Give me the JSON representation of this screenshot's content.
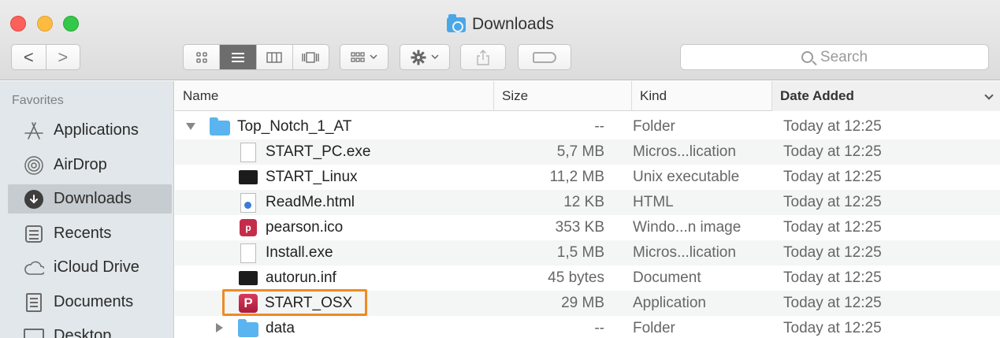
{
  "window": {
    "title": "Downloads"
  },
  "toolbar": {
    "back_label": "<",
    "forward_label": ">",
    "search_placeholder": "Search"
  },
  "sidebar": {
    "heading": "Favorites",
    "items": [
      {
        "label": "Applications",
        "icon": "applications-icon",
        "selected": false
      },
      {
        "label": "AirDrop",
        "icon": "airdrop-icon",
        "selected": false
      },
      {
        "label": "Downloads",
        "icon": "downloads-icon",
        "selected": true
      },
      {
        "label": "Recents",
        "icon": "recents-icon",
        "selected": false
      },
      {
        "label": "iCloud Drive",
        "icon": "cloud-icon",
        "selected": false
      },
      {
        "label": "Documents",
        "icon": "documents-icon",
        "selected": false
      },
      {
        "label": "Desktop",
        "icon": "desktop-icon",
        "selected": false
      }
    ]
  },
  "columns": {
    "name": "Name",
    "size": "Size",
    "kind": "Kind",
    "date_added": "Date Added"
  },
  "files": [
    {
      "name": "Top_Notch_1_AT",
      "size": "--",
      "kind": "Folder",
      "date": "Today at 12:25",
      "icon": "folder-icon",
      "indent": 0,
      "disclosure": "open"
    },
    {
      "name": "START_PC.exe",
      "size": "5,7 MB",
      "kind": "Micros...lication",
      "date": "Today at 12:25",
      "icon": "exe-file-icon",
      "indent": 1
    },
    {
      "name": "START_Linux",
      "size": "11,2 MB",
      "kind": "Unix executable",
      "date": "Today at 12:25",
      "icon": "unix-exec-icon",
      "indent": 1
    },
    {
      "name": "ReadMe.html",
      "size": "12 KB",
      "kind": "HTML",
      "date": "Today at 12:25",
      "icon": "html-file-icon",
      "indent": 1
    },
    {
      "name": "pearson.ico",
      "size": "353 KB",
      "kind": "Windo...n image",
      "date": "Today at 12:25",
      "icon": "ico-file-icon",
      "indent": 1
    },
    {
      "name": "Install.exe",
      "size": "1,5 MB",
      "kind": "Micros...lication",
      "date": "Today at 12:25",
      "icon": "exe-file-icon",
      "indent": 1
    },
    {
      "name": "autorun.inf",
      "size": "45 bytes",
      "kind": "Document",
      "date": "Today at 12:25",
      "icon": "inf-file-icon",
      "indent": 1
    },
    {
      "name": "START_OSX",
      "size": "29 MB",
      "kind": "Application",
      "date": "Today at 12:25",
      "icon": "pearson-app-icon",
      "indent": 1,
      "highlighted": true
    },
    {
      "name": "data",
      "size": "--",
      "kind": "Folder",
      "date": "Today at 12:25",
      "icon": "folder-icon",
      "indent": 1,
      "disclosure": "closed"
    }
  ],
  "colors": {
    "highlight": "#ee8a25",
    "folder": "#5ab4ef",
    "sidebar_bg": "#e1e7ea"
  }
}
